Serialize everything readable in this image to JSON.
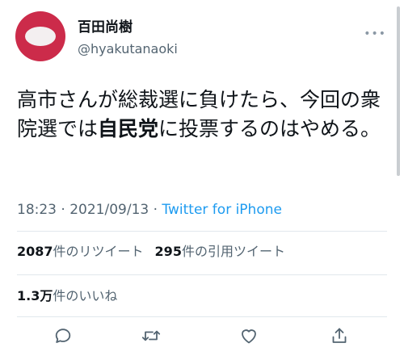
{
  "author": {
    "display_name": "百田尚樹",
    "handle": "@hyakutanaoki",
    "avatar_color": "#cc2b4a"
  },
  "tweet": {
    "text_before": "高市さんが総裁選に負けたら、今回の衆院選では",
    "text_bold": "自民党",
    "text_after": "に投票するのはやめる。"
  },
  "meta": {
    "time": "18:23",
    "separator1": " · ",
    "date": "2021/09/13",
    "separator2": " · ",
    "source": "Twitter for iPhone",
    "source_color": "#1d9bf0"
  },
  "stats": {
    "retweets_count": "2087",
    "retweets_label": "件のリツイート",
    "quotes_count": "295",
    "quotes_label": "件の引用ツイート",
    "likes_count": "1.3万",
    "likes_label": "件のいいね"
  },
  "actions": {
    "reply_icon": "reply-icon",
    "retweet_icon": "retweet-icon",
    "like_icon": "heart-icon",
    "share_icon": "share-icon"
  }
}
